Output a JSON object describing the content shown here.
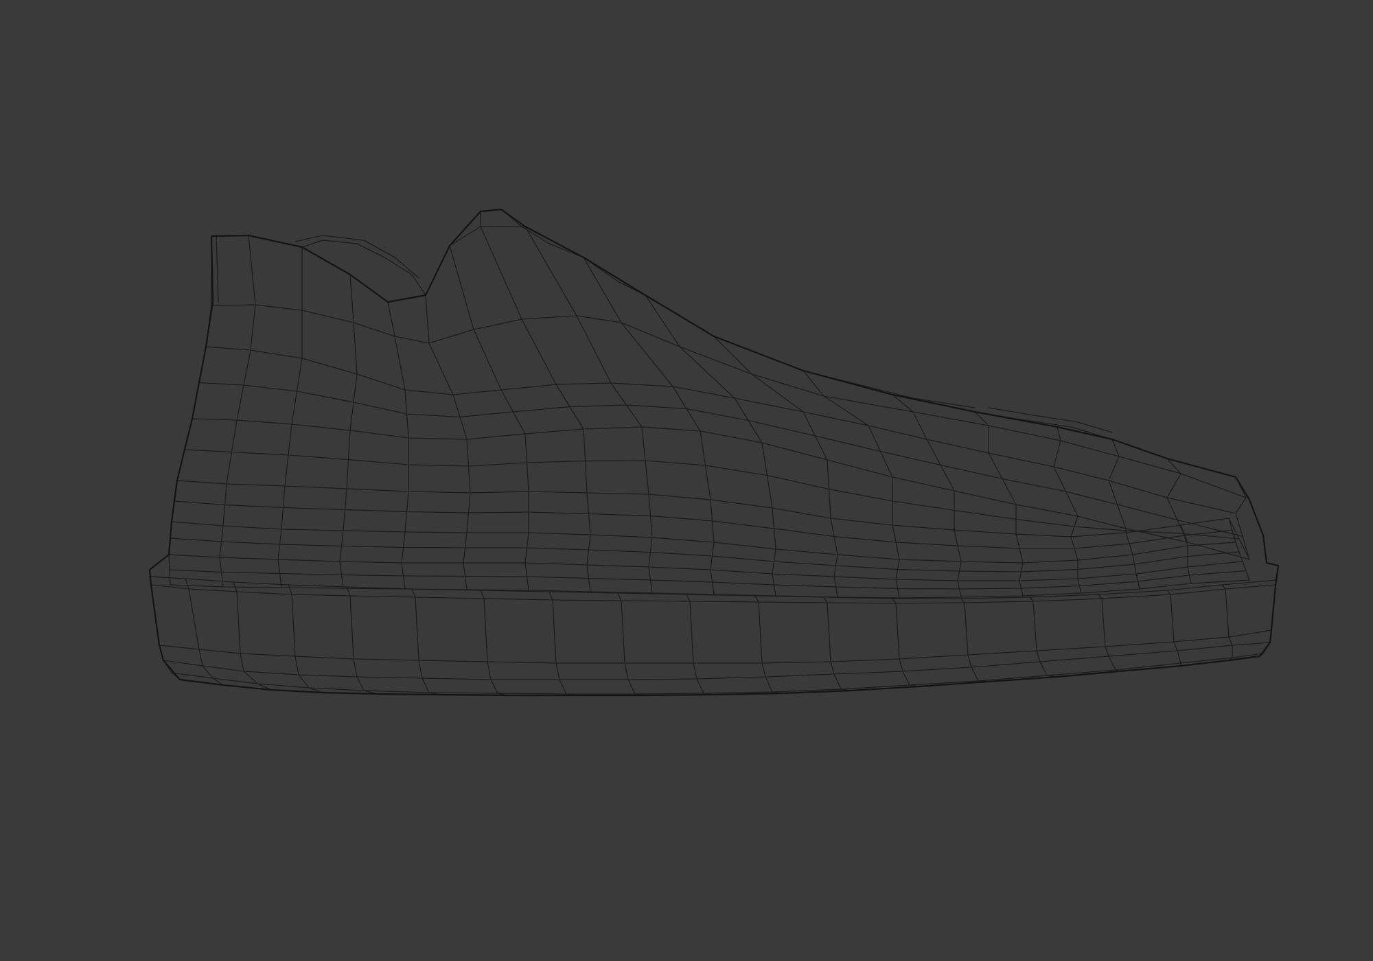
{
  "viewport": {
    "background_color": "#3a3a3a",
    "wire_color": "#1d1d1d",
    "outline_color": "#141414",
    "subject": "sneaker-wireframe-mesh",
    "view": "side"
  }
}
